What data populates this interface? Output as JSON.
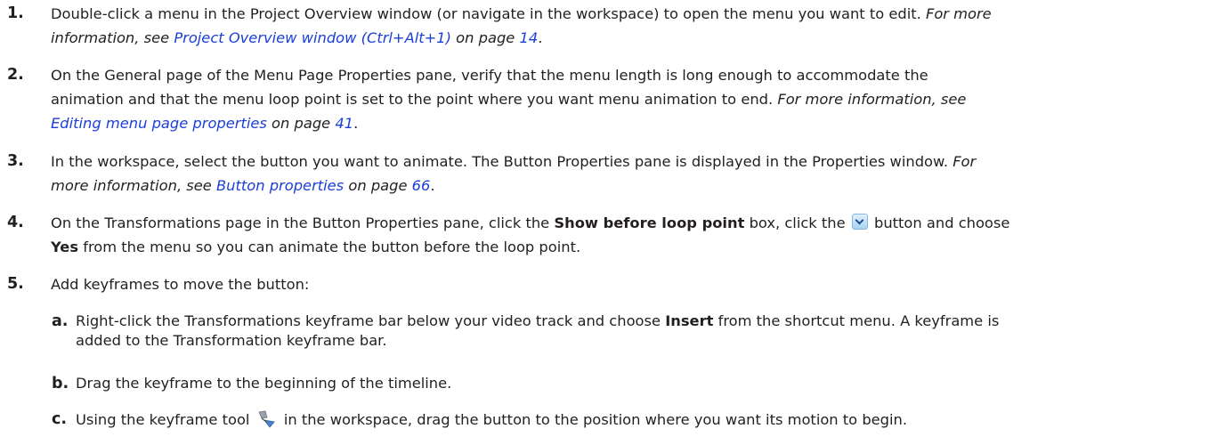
{
  "steps": [
    {
      "num": "1.",
      "lines": [
        {
          "a": "Double-click a menu in the Project Overview window (or navigate in the workspace) to open the menu you want to edit.",
          "b": "For more"
        },
        {
          "a": "information, see",
          "link": "Project Overview window (Ctrl+Alt+1)",
          "b": "on page",
          "page": "14",
          "end": "."
        }
      ]
    },
    {
      "num": "2.",
      "lines": [
        {
          "a": "On the General page of the Menu Page Properties pane, verify that the menu length is long enough to accommodate the"
        },
        {
          "a": "animation and that the menu loop point is set to the point where you want menu animation to end.",
          "b": "For more information, see"
        },
        {
          "link": "Editing menu page properties",
          "b": "on page",
          "page": "41",
          "end": "."
        }
      ]
    },
    {
      "num": "3.",
      "lines": [
        {
          "a": "In the workspace, select the button you want to animate. The Button Properties pane is displayed in the Properties window.",
          "b": "For"
        },
        {
          "a": "more information, see",
          "link": "Button properties",
          "b": "on page",
          "page": "66",
          "end": "."
        }
      ]
    },
    {
      "num": "4.",
      "line1": {
        "a": "On the Transformations page in the Button Properties pane, click the",
        "bold": "Show before loop point",
        "b": "box, click the",
        "c": "button and choose"
      },
      "line2": {
        "bold": "Yes",
        "a": "from the menu so you can animate the button before the loop point."
      }
    },
    {
      "num": "5.",
      "text": "Add keyframes to move the button:"
    }
  ],
  "substeps": [
    {
      "num": "a.",
      "line1": {
        "a": "Right-click the Transformations keyframe bar below your video track and choose",
        "bold": "Insert",
        "b": "from the shortcut menu. A keyframe is"
      },
      "line2": "added to the Transformation keyframe bar."
    },
    {
      "num": "b.",
      "text": "Drag the keyframe to the beginning of the timeline."
    },
    {
      "num": "c.",
      "a": "Using the keyframe tool",
      "b": "in the workspace, drag the button to the position where you want its motion to begin."
    }
  ],
  "icons": {
    "dropdown": "dropdown-button-icon",
    "keyframe_tool": "keyframe-tool-icon"
  },
  "colors": {
    "link": "#1a3fd6",
    "text": "#231f20"
  }
}
